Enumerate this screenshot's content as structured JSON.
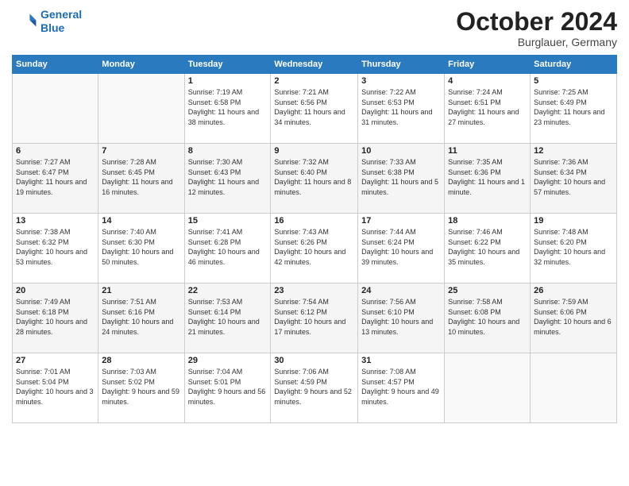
{
  "header": {
    "logo_line1": "General",
    "logo_line2": "Blue",
    "month": "October 2024",
    "location": "Burglauer, Germany"
  },
  "weekdays": [
    "Sunday",
    "Monday",
    "Tuesday",
    "Wednesday",
    "Thursday",
    "Friday",
    "Saturday"
  ],
  "weeks": [
    [
      {
        "day": "",
        "info": ""
      },
      {
        "day": "",
        "info": ""
      },
      {
        "day": "1",
        "info": "Sunrise: 7:19 AM\nSunset: 6:58 PM\nDaylight: 11 hours and 38 minutes."
      },
      {
        "day": "2",
        "info": "Sunrise: 7:21 AM\nSunset: 6:56 PM\nDaylight: 11 hours and 34 minutes."
      },
      {
        "day": "3",
        "info": "Sunrise: 7:22 AM\nSunset: 6:53 PM\nDaylight: 11 hours and 31 minutes."
      },
      {
        "day": "4",
        "info": "Sunrise: 7:24 AM\nSunset: 6:51 PM\nDaylight: 11 hours and 27 minutes."
      },
      {
        "day": "5",
        "info": "Sunrise: 7:25 AM\nSunset: 6:49 PM\nDaylight: 11 hours and 23 minutes."
      }
    ],
    [
      {
        "day": "6",
        "info": "Sunrise: 7:27 AM\nSunset: 6:47 PM\nDaylight: 11 hours and 19 minutes."
      },
      {
        "day": "7",
        "info": "Sunrise: 7:28 AM\nSunset: 6:45 PM\nDaylight: 11 hours and 16 minutes."
      },
      {
        "day": "8",
        "info": "Sunrise: 7:30 AM\nSunset: 6:43 PM\nDaylight: 11 hours and 12 minutes."
      },
      {
        "day": "9",
        "info": "Sunrise: 7:32 AM\nSunset: 6:40 PM\nDaylight: 11 hours and 8 minutes."
      },
      {
        "day": "10",
        "info": "Sunrise: 7:33 AM\nSunset: 6:38 PM\nDaylight: 11 hours and 5 minutes."
      },
      {
        "day": "11",
        "info": "Sunrise: 7:35 AM\nSunset: 6:36 PM\nDaylight: 11 hours and 1 minute."
      },
      {
        "day": "12",
        "info": "Sunrise: 7:36 AM\nSunset: 6:34 PM\nDaylight: 10 hours and 57 minutes."
      }
    ],
    [
      {
        "day": "13",
        "info": "Sunrise: 7:38 AM\nSunset: 6:32 PM\nDaylight: 10 hours and 53 minutes."
      },
      {
        "day": "14",
        "info": "Sunrise: 7:40 AM\nSunset: 6:30 PM\nDaylight: 10 hours and 50 minutes."
      },
      {
        "day": "15",
        "info": "Sunrise: 7:41 AM\nSunset: 6:28 PM\nDaylight: 10 hours and 46 minutes."
      },
      {
        "day": "16",
        "info": "Sunrise: 7:43 AM\nSunset: 6:26 PM\nDaylight: 10 hours and 42 minutes."
      },
      {
        "day": "17",
        "info": "Sunrise: 7:44 AM\nSunset: 6:24 PM\nDaylight: 10 hours and 39 minutes."
      },
      {
        "day": "18",
        "info": "Sunrise: 7:46 AM\nSunset: 6:22 PM\nDaylight: 10 hours and 35 minutes."
      },
      {
        "day": "19",
        "info": "Sunrise: 7:48 AM\nSunset: 6:20 PM\nDaylight: 10 hours and 32 minutes."
      }
    ],
    [
      {
        "day": "20",
        "info": "Sunrise: 7:49 AM\nSunset: 6:18 PM\nDaylight: 10 hours and 28 minutes."
      },
      {
        "day": "21",
        "info": "Sunrise: 7:51 AM\nSunset: 6:16 PM\nDaylight: 10 hours and 24 minutes."
      },
      {
        "day": "22",
        "info": "Sunrise: 7:53 AM\nSunset: 6:14 PM\nDaylight: 10 hours and 21 minutes."
      },
      {
        "day": "23",
        "info": "Sunrise: 7:54 AM\nSunset: 6:12 PM\nDaylight: 10 hours and 17 minutes."
      },
      {
        "day": "24",
        "info": "Sunrise: 7:56 AM\nSunset: 6:10 PM\nDaylight: 10 hours and 13 minutes."
      },
      {
        "day": "25",
        "info": "Sunrise: 7:58 AM\nSunset: 6:08 PM\nDaylight: 10 hours and 10 minutes."
      },
      {
        "day": "26",
        "info": "Sunrise: 7:59 AM\nSunset: 6:06 PM\nDaylight: 10 hours and 6 minutes."
      }
    ],
    [
      {
        "day": "27",
        "info": "Sunrise: 7:01 AM\nSunset: 5:04 PM\nDaylight: 10 hours and 3 minutes."
      },
      {
        "day": "28",
        "info": "Sunrise: 7:03 AM\nSunset: 5:02 PM\nDaylight: 9 hours and 59 minutes."
      },
      {
        "day": "29",
        "info": "Sunrise: 7:04 AM\nSunset: 5:01 PM\nDaylight: 9 hours and 56 minutes."
      },
      {
        "day": "30",
        "info": "Sunrise: 7:06 AM\nSunset: 4:59 PM\nDaylight: 9 hours and 52 minutes."
      },
      {
        "day": "31",
        "info": "Sunrise: 7:08 AM\nSunset: 4:57 PM\nDaylight: 9 hours and 49 minutes."
      },
      {
        "day": "",
        "info": ""
      },
      {
        "day": "",
        "info": ""
      }
    ]
  ]
}
